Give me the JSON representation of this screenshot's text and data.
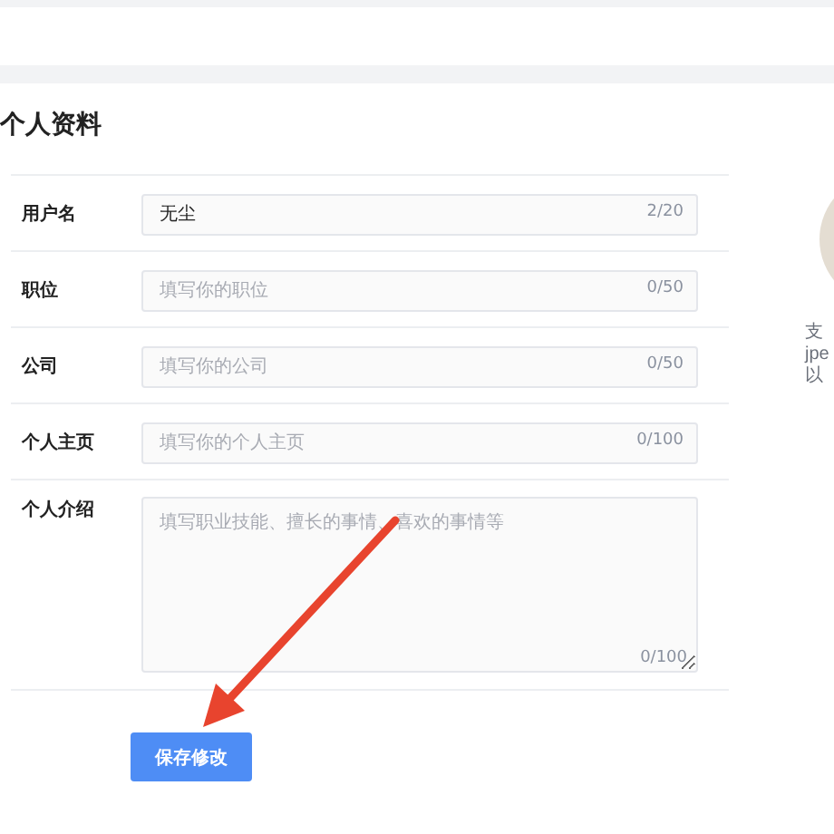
{
  "heading": "个人资料",
  "fields": [
    {
      "label": "用户名",
      "kind": "input",
      "value": "无尘",
      "counter": "2/20"
    },
    {
      "label": "职位",
      "kind": "input",
      "placeholder": "填写你的职位",
      "counter": "0/50"
    },
    {
      "label": "公司",
      "kind": "input",
      "placeholder": "填写你的公司",
      "counter": "0/50"
    },
    {
      "label": "个人主页",
      "kind": "input",
      "placeholder": "填写你的个人主页",
      "counter": "0/100"
    },
    {
      "label": "个人介绍",
      "kind": "textarea",
      "placeholder": "填写职业技能、擅长的事情、喜欢的事情等",
      "counter": "0/100"
    }
  ],
  "save_button": "保存修改",
  "avatar_hint": [
    "支",
    "jpe",
    "以"
  ]
}
